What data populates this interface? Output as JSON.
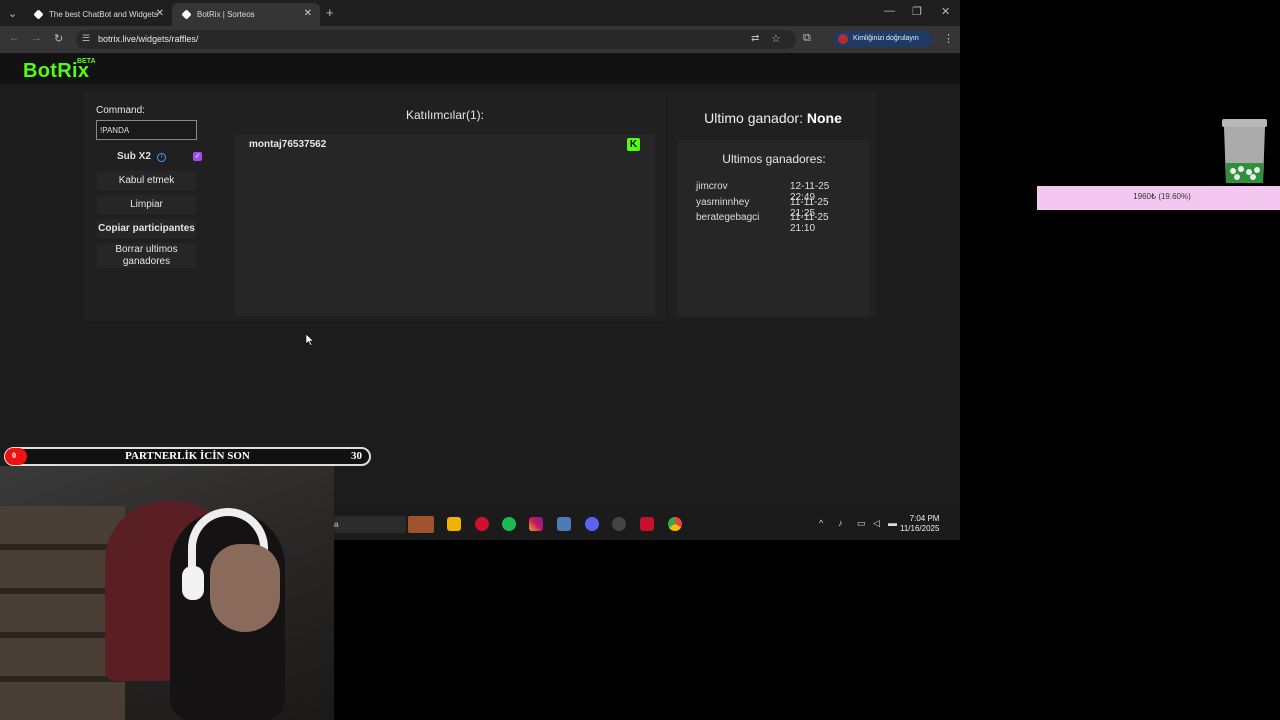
{
  "browser": {
    "tabs": [
      {
        "title": "The best ChatBot and Widgets"
      },
      {
        "title": "BotRix | Sorteos"
      }
    ],
    "url": "botrix.live/widgets/raffles/",
    "profile_label": "Kimliğinizi doğrulayın"
  },
  "app": {
    "logo": "BotRix",
    "beta": "BETA"
  },
  "controls": {
    "command_label": "Command:",
    "command_value": "!PANDA",
    "sub_label": "Sub X2",
    "sub_checked": true,
    "accept_label": "Kabul etmek",
    "clear_label": "Limpiar",
    "copy_label": "Copiar participantes",
    "delete_winners_label": "Borrar ultimos ganadores"
  },
  "participants": {
    "title": "Katılımcılar(1):",
    "items": [
      {
        "name": "montaj76537562",
        "platform": "kick"
      }
    ]
  },
  "winners": {
    "last_label": "Ultimo ganador:",
    "last_value": "None",
    "list_title": "Ultimos ganadores:",
    "items": [
      {
        "name": "jimcrov",
        "date": "12-11-25 22:49"
      },
      {
        "name": "yasminnhey",
        "date": "11-11-25 21:25"
      },
      {
        "name": "berategebagci",
        "date": "11-11-25 21:10"
      }
    ]
  },
  "taskbar": {
    "search_fragment": "a",
    "time": "7:04 PM",
    "date": "11/16/2025"
  },
  "overlay": {
    "partner_count_left": "0",
    "partner_text": "PARTNERLİK İCİN SON",
    "partner_count_right": "30",
    "goal_text": "1960₺ (19.60%)",
    "goal_progress": 0.196
  },
  "colors": {
    "kick_green": "#53fc18",
    "checkbox_purple": "#a14cf0",
    "goal_pink": "#f4c7f0"
  }
}
